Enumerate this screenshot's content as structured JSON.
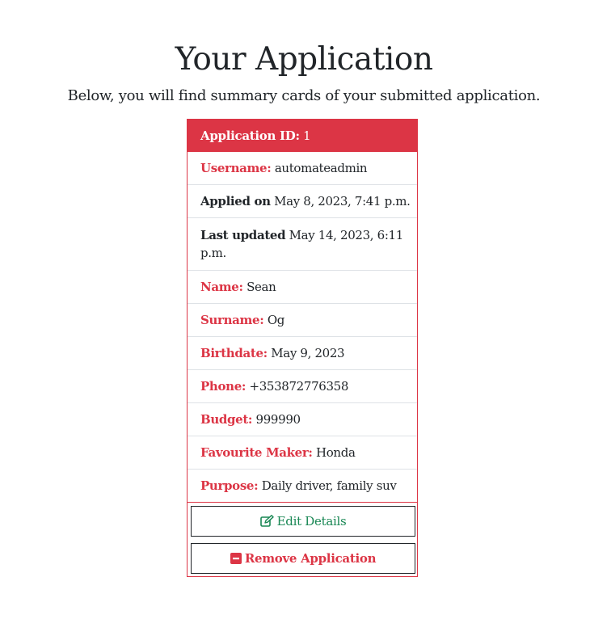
{
  "page": {
    "title": "Your Application",
    "subtitle": "Below, you will find summary cards of your submitted application."
  },
  "card": {
    "header": {
      "label": "Application ID:",
      "value": "1"
    },
    "rows": [
      {
        "key": "Username:",
        "value": "automateadmin"
      },
      {
        "key": "Applied on",
        "value": "May 8, 2023, 7:41 p.m."
      },
      {
        "key": "Last updated",
        "value": "May 14, 2023, 6:11 p.m."
      },
      {
        "key": "Name:",
        "value": "Sean"
      },
      {
        "key": "Surname:",
        "value": "Og"
      },
      {
        "key": "Birthdate:",
        "value": "May 9, 2023"
      },
      {
        "key": "Phone:",
        "value": "+353872776358"
      },
      {
        "key": "Budget:",
        "value": "999990"
      },
      {
        "key": "Favourite Maker:",
        "value": "Honda"
      },
      {
        "key": "Purpose:",
        "value": "Daily driver, family suv"
      }
    ],
    "actions": {
      "edit_label": "Edit Details",
      "edit_icon": "edit-icon",
      "remove_label": "Remove Application",
      "remove_icon": "minus-square-icon"
    }
  },
  "colors": {
    "accent": "#dc3545",
    "edit": "#198754",
    "text": "#212529"
  }
}
